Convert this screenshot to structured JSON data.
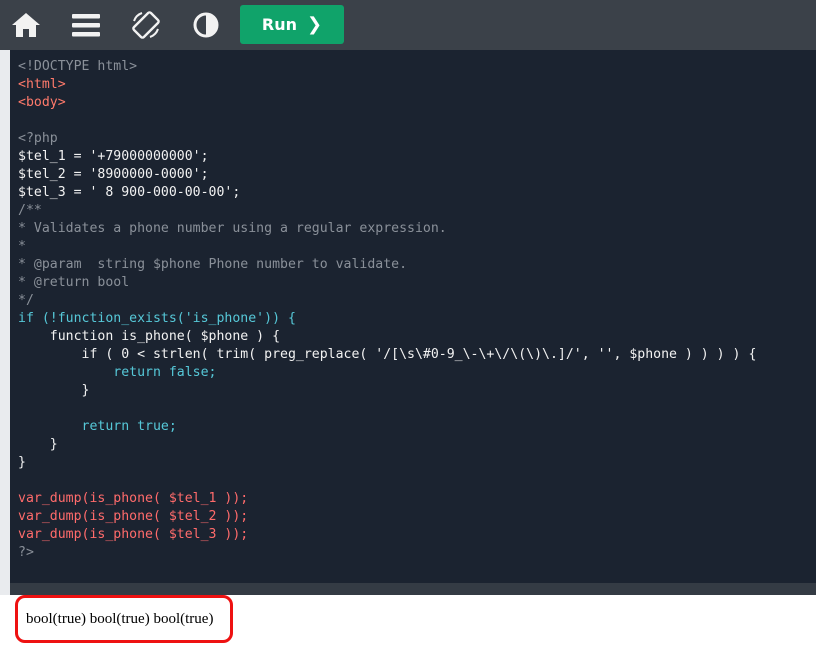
{
  "toolbar": {
    "home_icon": "home-icon",
    "menu_icon": "hamburger-menu-icon",
    "rotate_icon": "rotate-screen-icon",
    "theme_icon": "contrast-icon",
    "run_label": "Run",
    "run_chevron": "❯"
  },
  "code_lines": [
    "<!DOCTYPE html>",
    "<html>",
    "<body>",
    "",
    "<?php",
    "$tel_1 = '+79000000000';",
    "$tel_2 = '8900000-0000';",
    "$tel_3 = ' 8 900-000-00-00';",
    "/**",
    "* Validates a phone number using a regular expression.",
    "*",
    "* @param  string $phone Phone number to validate.",
    "* @return bool",
    "*/",
    "if (!function_exists('is_phone')) {",
    "    function is_phone( $phone ) {",
    "        if ( 0 < strlen( trim( preg_replace( '/[\\s\\#0-9_\\-\\+\\/\\(\\)\\.]/', '', $phone ) ) ) ) {",
    "            return false;",
    "        }",
    "",
    "        return true;",
    "    }",
    "}",
    "",
    "var_dump(is_phone( $tel_1 ));",
    "var_dump(is_phone( $tel_2 ));",
    "var_dump(is_phone( $tel_3 ));",
    "?>"
  ],
  "output": {
    "text": "bool(true) bool(true) bool(true)"
  },
  "colors": {
    "toolbar_bg": "#3b4149",
    "editor_bg": "#1b2330",
    "run_button": "#10a36a",
    "highlight": "#ee1111"
  }
}
